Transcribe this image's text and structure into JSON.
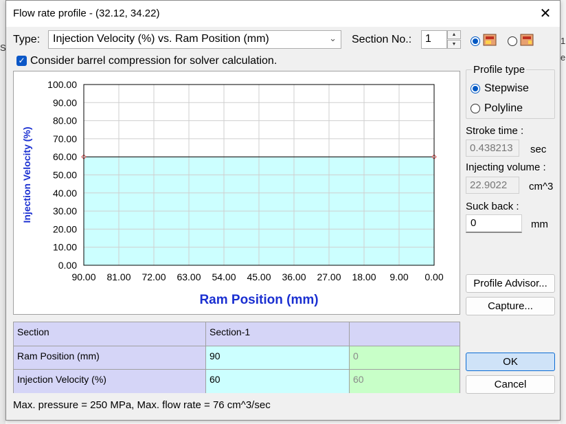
{
  "window": {
    "title": "Flow rate profile - (32.12, 34.22)",
    "close_glyph": "✕"
  },
  "background": {
    "fragment_left": "Sc",
    "fragment_right_top": "1",
    "fragment_right_mid": "el"
  },
  "toolbar": {
    "type_label": "Type:",
    "type_value": "Injection Velocity (%) vs. Ram Position (mm)",
    "section_label": "Section No.:",
    "section_value": "1",
    "mode_icons": [
      "mold-icon",
      "mold-icon"
    ]
  },
  "compression": {
    "label": "Consider barrel compression for solver calculation.",
    "checked": true
  },
  "chart_data": {
    "type": "area",
    "ylabel": "Injection Velocity (%)",
    "xlabel": "Ram Position (mm)",
    "y_ticks": [
      "100.00",
      "90.00",
      "80.00",
      "70.00",
      "60.00",
      "50.00",
      "40.00",
      "30.00",
      "20.00",
      "10.00",
      "0.00"
    ],
    "x_ticks": [
      "90.00",
      "81.00",
      "72.00",
      "63.00",
      "54.00",
      "45.00",
      "36.00",
      "27.00",
      "18.00",
      "9.00",
      "0.00"
    ],
    "ylim": [
      0,
      100
    ],
    "xlim": [
      90,
      0
    ],
    "grid": true,
    "profile": "stepwise",
    "points": [
      {
        "x": 90,
        "y": 60
      },
      {
        "x": 0,
        "y": 60
      }
    ],
    "fill_color": "#ccffff",
    "axis_title_color": "#1a2fd1",
    "ylabel_color": "#1a2fd1"
  },
  "profile_type": {
    "legend": "Profile type",
    "options": [
      "Stepwise",
      "Polyline"
    ],
    "selected": 0
  },
  "stroke_time": {
    "label": "Stroke time :",
    "value": "0.438213",
    "unit": "sec"
  },
  "injecting_volume": {
    "label": "Injecting volume :",
    "value": "22.9022",
    "unit": "cm^3"
  },
  "suck_back": {
    "label": "Suck back :",
    "value": "0",
    "unit": "mm"
  },
  "buttons": {
    "advisor": "Profile Advisor...",
    "capture": "Capture...",
    "ok": "OK",
    "cancel": "Cancel"
  },
  "table": {
    "header": [
      "Section",
      "Section-1",
      ""
    ],
    "rows": [
      {
        "label": "Ram Position (mm)",
        "value": "90",
        "next": "0"
      },
      {
        "label": "Injection Velocity (%)",
        "value": "60",
        "next": "60"
      }
    ]
  },
  "footer": {
    "text": "Max. pressure = 250 MPa, Max. flow rate = 76 cm^3/sec"
  }
}
